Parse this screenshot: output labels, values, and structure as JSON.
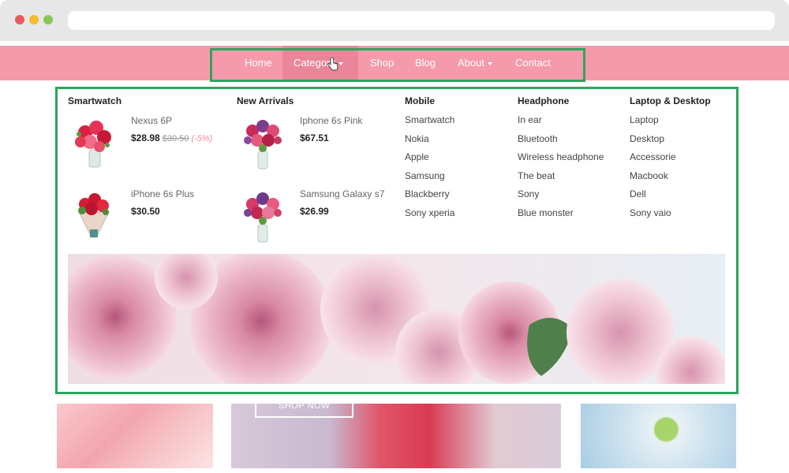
{
  "nav": {
    "items": [
      {
        "label": "Home"
      },
      {
        "label": "Category"
      },
      {
        "label": "Shop"
      },
      {
        "label": "Blog"
      },
      {
        "label": "About"
      },
      {
        "label": "Contact"
      }
    ]
  },
  "mega_menu": {
    "smartwatch": {
      "title": "Smartwatch",
      "products": [
        {
          "name": "Nexus 6P",
          "price": "$28.98",
          "old_price": "$30.50",
          "discount": "(-5%)"
        },
        {
          "name": "iPhone 6s Plus",
          "price": "$30.50"
        }
      ]
    },
    "new_arrivals": {
      "title": "New Arrivals",
      "products": [
        {
          "name": "Iphone 6s Pink",
          "price": "$67.51"
        },
        {
          "name": "Samsung Galaxy s7",
          "price": "$26.99"
        }
      ]
    },
    "mobile": {
      "title": "Mobile",
      "links": [
        "Smartwatch",
        "Nokia",
        "Apple",
        "Samsung",
        "Blackberry",
        "Sony xperia"
      ]
    },
    "headphone": {
      "title": "Headphone",
      "links": [
        "In ear",
        "Bluetooth",
        "Wireless headphone",
        "The beat",
        "Sony",
        "Blue monster"
      ]
    },
    "laptop": {
      "title": "Laptop & Desktop",
      "links": [
        "Laptop",
        "Desktop",
        "Accessorie",
        "Macbook",
        "Dell",
        "Sony vaio"
      ]
    }
  },
  "page": {
    "shop_now": "SHOP NOW"
  },
  "colors": {
    "navbar": "#f59aaa",
    "highlight": "#2aa75d",
    "discount": "#f0899a"
  },
  "icons": [
    "hand-cursor-icon",
    "caret-down-icon"
  ]
}
